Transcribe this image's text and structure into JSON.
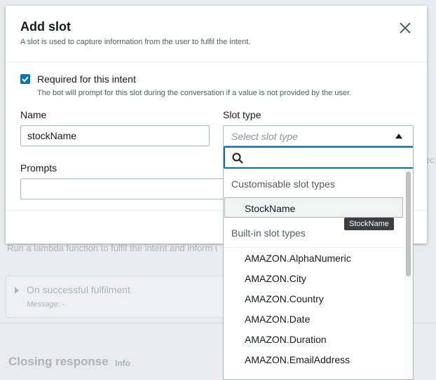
{
  "background": {
    "lambda_text": "Run a lambda function to fulfil the intent and inform use",
    "card_title": "On successful fulfilment",
    "card_message": "Message: -",
    "closing_heading": "Closing response",
    "closing_info": "Info",
    "side_fragment": "ec"
  },
  "modal": {
    "title": "Add slot",
    "subtitle": "A slot is used to capture information from the user to fulfil the intent.",
    "close_icon": "close-icon",
    "required": {
      "checked": true,
      "label": "Required for this intent",
      "description": "The bot will prompt for this slot during the conversation if a value is not provided by the user."
    },
    "name": {
      "label": "Name",
      "value": "stockName"
    },
    "slot_type": {
      "label": "Slot type",
      "placeholder": "Select slot type"
    },
    "prompts": {
      "label": "Prompts",
      "value": ""
    }
  },
  "dropdown": {
    "search_value": "",
    "custom_group": "Customisable slot types",
    "custom_items": [
      "StockName"
    ],
    "builtin_group": "Built-in slot types",
    "builtin_items": [
      "AMAZON.AlphaNumeric",
      "AMAZON.City",
      "AMAZON.Country",
      "AMAZON.Date",
      "AMAZON.Duration",
      "AMAZON.EmailAddress"
    ]
  },
  "tooltip": "StockName",
  "colors": {
    "accent": "#0073bb",
    "text": "#16191f",
    "muted": "#545b64"
  }
}
